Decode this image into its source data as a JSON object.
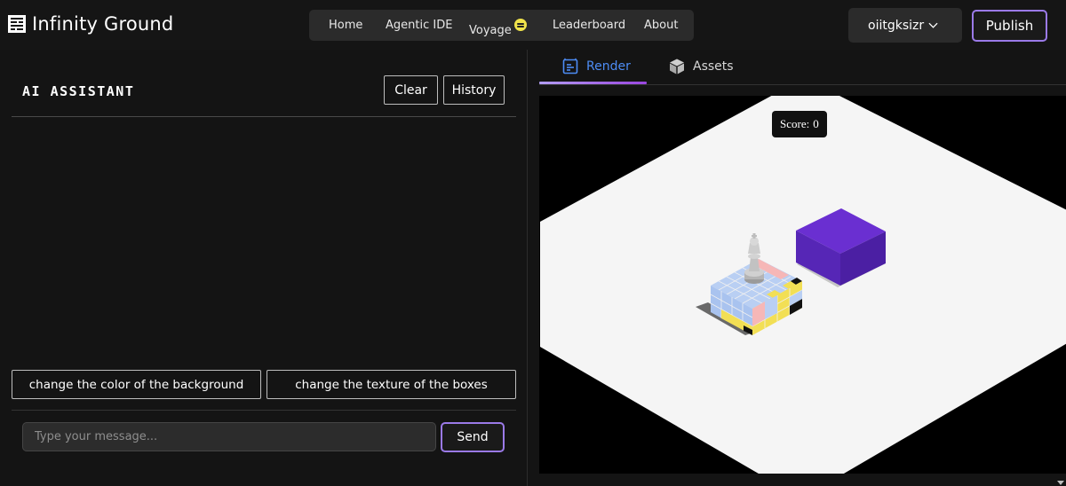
{
  "app": {
    "title": "Infinity Ground"
  },
  "nav": {
    "home": "Home",
    "agentic_ide": "Agentic IDE",
    "voyage": "Voyage",
    "leaderboard": "Leaderboard",
    "about": "About"
  },
  "user": {
    "name": "oiitgksizr"
  },
  "publish_label": "Publish",
  "assistant": {
    "title": "AI ASSISTANT",
    "clear_label": "Clear",
    "history_label": "History",
    "suggestions": [
      "change the color of the background",
      "change the texture of the boxes"
    ],
    "input_placeholder": "Type your message...",
    "send_label": "Send"
  },
  "tabs": {
    "render": "Render",
    "assets": "Assets"
  },
  "game": {
    "score_label": "Score:",
    "score_value": "0"
  },
  "colors": {
    "accent_purple": "#9b7ae8",
    "render_tab_blue": "#4d8cf5",
    "voyage_yellow": "#f1e44b",
    "purple_block": "#6a2fd1"
  }
}
